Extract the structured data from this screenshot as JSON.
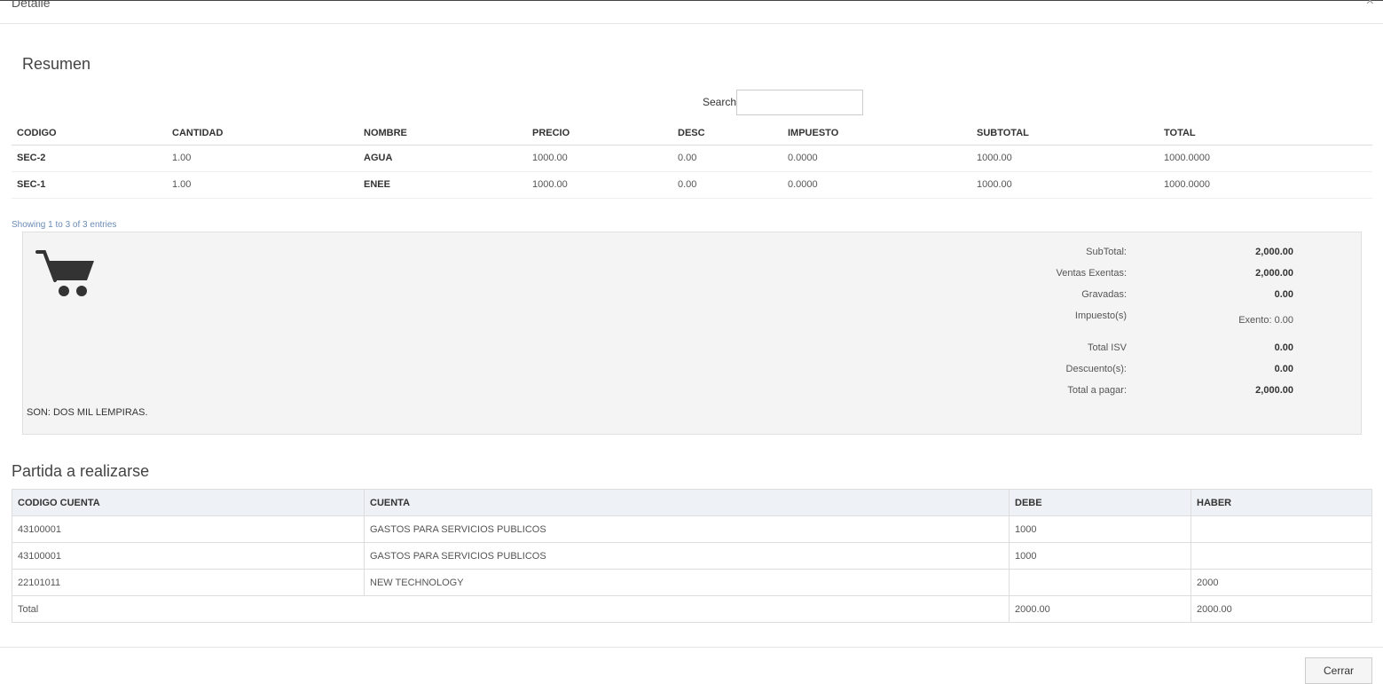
{
  "modal": {
    "title": "Detalle",
    "close_glyph": "×"
  },
  "resumen": {
    "title": "Resumen",
    "search_label": "Search:",
    "search_value": "",
    "columns": [
      "CODIGO",
      "CANTIDAD",
      "NOMBRE",
      "PRECIO",
      "DESC",
      "IMPUESTO",
      "SUBTOTAL",
      "TOTAL"
    ],
    "rows": [
      [
        "SEC-2",
        "1.00",
        "AGUA",
        "1000.00",
        "0.00",
        "0.0000",
        "1000.00",
        "1000.0000"
      ],
      [
        "SEC-1",
        "1.00",
        "ENEE",
        "1000.00",
        "0.00",
        "0.0000",
        "1000.00",
        "1000.0000"
      ]
    ],
    "showing": "Showing 1 to 3 of 3 entries"
  },
  "totals": {
    "icon": "shopping-cart-icon",
    "son": "SON: DOS MIL LEMPIRAS.",
    "items": [
      {
        "label": "SubTotal:",
        "value": "2,000.00"
      },
      {
        "label": "Ventas Exentas:",
        "value": "2,000.00"
      },
      {
        "label": "Gravadas:",
        "value": "0.00"
      },
      {
        "label": "Impuesto(s)",
        "value": "Exento: 0.00"
      },
      {
        "label": "Total ISV",
        "value": "0.00"
      },
      {
        "label": "Descuento(s):",
        "value": "0.00"
      },
      {
        "label": "Total a pagar:",
        "value": "2,000.00"
      }
    ]
  },
  "partida": {
    "title": "Partida a realizarse",
    "columns": [
      "CODIGO CUENTA",
      "CUENTA",
      "DEBE",
      "HABER"
    ],
    "rows": [
      [
        "43100001",
        "GASTOS PARA SERVICIOS PUBLICOS",
        "1000",
        ""
      ],
      [
        "43100001",
        "GASTOS PARA SERVICIOS PUBLICOS",
        "1000",
        ""
      ],
      [
        "22101011",
        "NEW TECHNOLOGY",
        "",
        "2000"
      ],
      [
        "Total",
        "",
        "2000.00",
        "2000.00"
      ]
    ]
  },
  "footer": {
    "close_label": "Cerrar"
  }
}
